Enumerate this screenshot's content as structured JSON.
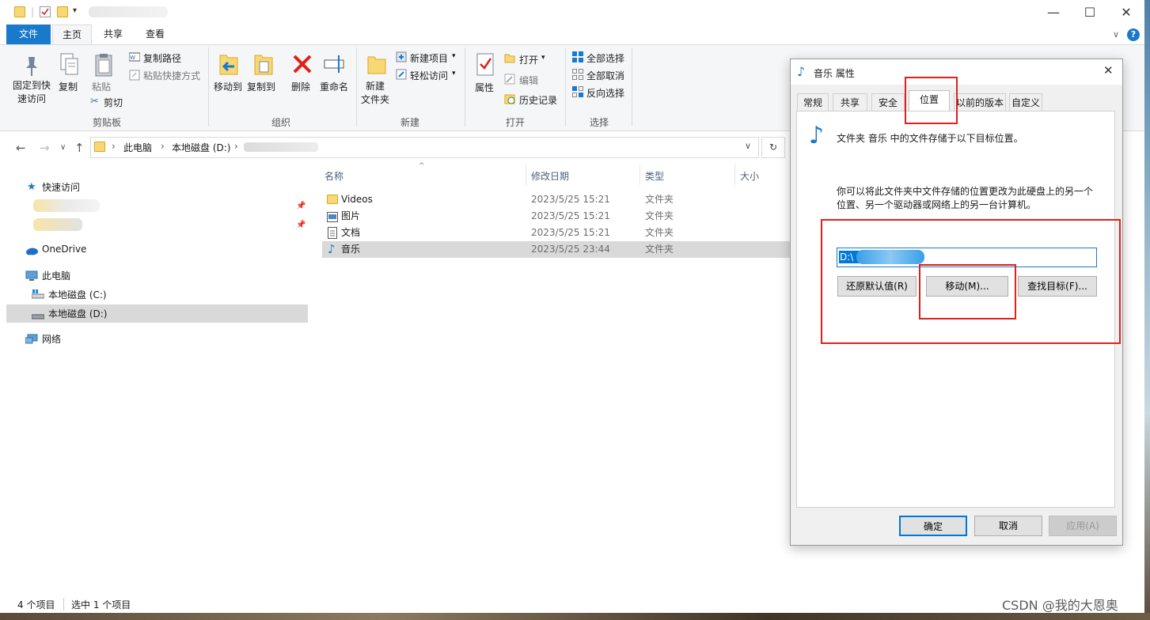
{
  "window": {
    "title_blurred": "",
    "controls": {
      "minimize": "—",
      "maximize": "☐",
      "close": "✕"
    }
  },
  "ribbon": {
    "tabs": [
      "文件",
      "主页",
      "共享",
      "查看"
    ],
    "clipboard": {
      "pin": "固定到快速访问",
      "copy": "复制",
      "paste": "粘贴",
      "copy_path": "复制路径",
      "paste_shortcut": "粘贴快捷方式",
      "cut": "剪切",
      "group": "剪贴板"
    },
    "organize": {
      "move_to": "移动到",
      "copy_to": "复制到",
      "delete": "删除",
      "rename": "重命名",
      "group": "组织"
    },
    "new": {
      "new_folder": "新建\n文件夹",
      "new_item": "新建项目",
      "easy_access": "轻松访问",
      "group": "新建"
    },
    "open": {
      "properties": "属性",
      "open": "打开",
      "edit": "编辑",
      "history": "历史记录",
      "group": "打开"
    },
    "select": {
      "select_all": "全部选择",
      "select_none": "全部取消",
      "invert": "反向选择",
      "group": "选择"
    }
  },
  "address": {
    "crumbs": [
      "此电脑",
      "本地磁盘 (D:)"
    ],
    "sep": "›"
  },
  "nav": {
    "quick_access": "快速访问",
    "onedrive": "OneDrive",
    "this_pc": "此电脑",
    "drive_c": "本地磁盘 (C:)",
    "drive_d": "本地磁盘 (D:)",
    "network": "网络"
  },
  "files": {
    "headers": {
      "name": "名称",
      "date": "修改日期",
      "type": "类型",
      "size": "大小"
    },
    "rows": [
      {
        "name": "Videos",
        "date": "2023/5/25 15:21",
        "type": "文件夹",
        "icon": "folder"
      },
      {
        "name": "图片",
        "date": "2023/5/25 15:21",
        "type": "文件夹",
        "icon": "pictures"
      },
      {
        "name": "文档",
        "date": "2023/5/25 15:21",
        "type": "文件夹",
        "icon": "documents"
      },
      {
        "name": "音乐",
        "date": "2023/5/25 23:44",
        "type": "文件夹",
        "icon": "music"
      }
    ]
  },
  "status": {
    "count": "4 个项目",
    "selected": "选中 1 个项目"
  },
  "dialog": {
    "title": "音乐 属性",
    "tabs": [
      "常规",
      "共享",
      "安全",
      "位置",
      "以前的版本",
      "自定义"
    ],
    "info": "文件夹 音乐 中的文件存储于以下目标位置。",
    "desc_line1": "你可以将此文件夹中文件存储的位置更改为此硬盘上的另一个",
    "desc_line2": "位置、另一个驱动器或网络上的另一台计算机。",
    "path_value": "D:\\",
    "restore_btn": "还原默认值(R)",
    "move_btn": "移动(M)...",
    "find_btn": "查找目标(F)...",
    "ok": "确定",
    "cancel": "取消",
    "apply": "应用(A)"
  },
  "watermark": "CSDN @我的大恩奥",
  "colors": {
    "accent": "#1979ca",
    "highlight": "#e0201b",
    "selection": "#d9d9d9"
  }
}
